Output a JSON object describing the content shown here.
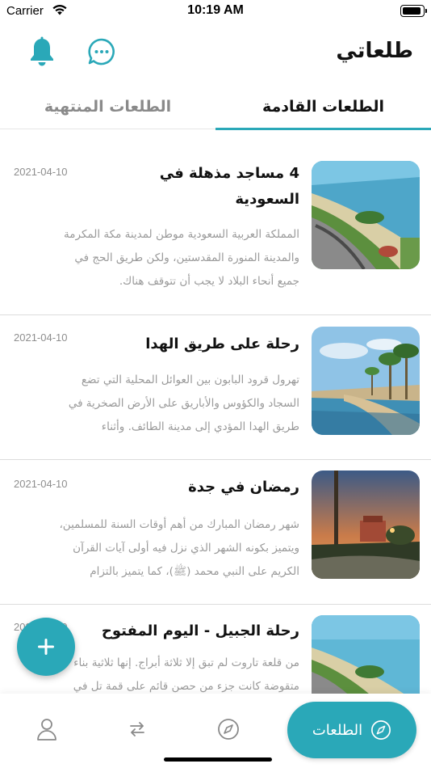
{
  "status_bar": {
    "carrier": "Carrier",
    "time": "10:19 AM"
  },
  "header": {
    "title": "طلعاتي",
    "bell_icon": "bell-icon",
    "chat_icon": "chat-bubble-icon"
  },
  "tabs": [
    {
      "label": "الطلعات القادمة",
      "active": true
    },
    {
      "label": "الطلعات المنتهية",
      "active": false
    }
  ],
  "trips": [
    {
      "title": "4 مساجد مذهلة في السعودية",
      "date": "2021-04-10",
      "description": "المملكة العربية السعودية موطن لمدينة مكة المكرمة والمدينة المنورة المقدستين، ولكن طريق الحج في جميع أنحاء البلاد لا يجب أن تتوقف هناك.",
      "image": "coastal-road-aerial"
    },
    {
      "title": "رحلة على طريق الهدا",
      "date": "2021-04-10",
      "description": "تهرول قرود البابون بين العوائل المحلية التي تضع السجاد والكؤوس والأباريق على الأرض الصخرية في طريق الهدا المؤدي إلى مدينة الطائف. وأثناء",
      "image": "palm-corniche-water"
    },
    {
      "title": "رمضان في جدة",
      "date": "2021-04-10",
      "description": "شهر رمضان المبارك من أهم أوقات السنة للمسلمين، ويتميز بكونه الشهر الذي نزل فيه أولى آيات القرآن الكريم على النبي محمد (ﷺ)، كما يتميز بالتزام",
      "image": "sunset-park"
    },
    {
      "title": "رحلة الجبيل - اليوم المفتوح",
      "date": "2021-04-10",
      "description": "من قلعة تاروت لم تبق إلا ثلاثة أبراج. إنها ثلاثية بناء متقوضة كانت جزء من حصن قائم على قمة تل في",
      "image": "coastal-road-aerial"
    }
  ],
  "fab": {
    "icon": "plus-icon"
  },
  "bottom_nav": {
    "active_label": "الطلعات",
    "active_icon": "compass-icon",
    "items": [
      "profile-icon",
      "swap-arrows-icon",
      "compass-icon"
    ]
  },
  "colors": {
    "accent": "#2aa8b8",
    "date": "#8e8e8e",
    "desc": "#9a9a9a"
  }
}
